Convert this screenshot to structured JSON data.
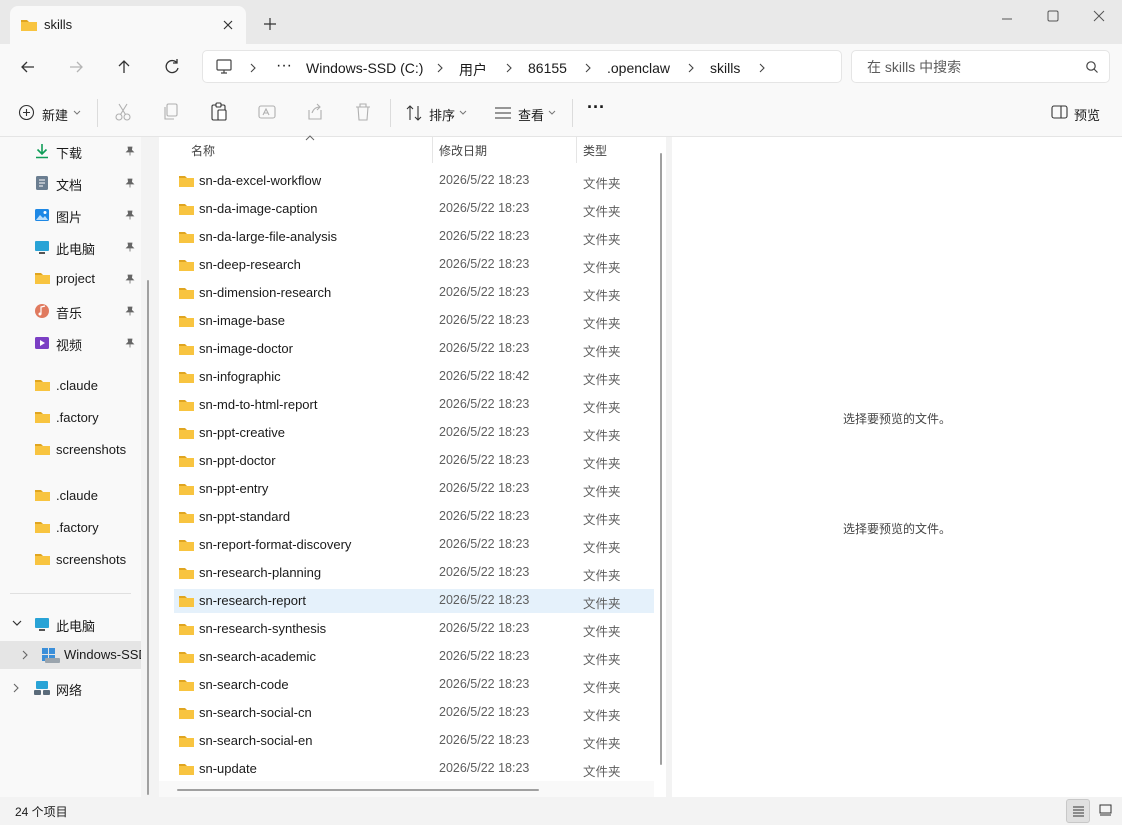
{
  "window": {
    "tab_title": "skills",
    "new_tab_glyph": "+",
    "controls": [
      "minimize-icon",
      "maximize-icon",
      "close-icon"
    ]
  },
  "address": {
    "computer_icon": "computer-icon",
    "more": "···",
    "crumbs": [
      "Windows-SSD (C:)",
      "用户",
      "86155",
      ".openclaw",
      "skills"
    ]
  },
  "search": {
    "placeholder": "在 skills 中搜索"
  },
  "toolbar": {
    "new_label": "新建",
    "sort_label": "排序",
    "view_label": "查看",
    "more_glyph": "···",
    "preview_label": "预览"
  },
  "sidebar": {
    "quick_access": [
      {
        "label": "下载",
        "icon": "download-icon"
      },
      {
        "label": "文档",
        "icon": "document-icon"
      },
      {
        "label": "图片",
        "icon": "pictures-icon"
      },
      {
        "label": "此电脑",
        "icon": "this-pc-icon"
      },
      {
        "label": "project",
        "icon": "folder-icon"
      },
      {
        "label": "音乐",
        "icon": "music-icon"
      },
      {
        "label": "视频",
        "icon": "video-icon"
      }
    ],
    "group1": [
      ".claude",
      ".factory",
      "screenshots"
    ],
    "group2": [
      ".claude",
      ".factory",
      "screenshots"
    ],
    "tree": {
      "this_pc": "此电脑",
      "drive": "Windows-SSD",
      "network": "网络"
    }
  },
  "list": {
    "columns": {
      "name": "名称",
      "date": "修改日期",
      "type": "类型"
    },
    "rows": [
      {
        "name": "sn-da-excel-workflow",
        "date": "2026/5/22 18:23",
        "type": "文件夹"
      },
      {
        "name": "sn-da-image-caption",
        "date": "2026/5/22 18:23",
        "type": "文件夹"
      },
      {
        "name": "sn-da-large-file-analysis",
        "date": "2026/5/22 18:23",
        "type": "文件夹"
      },
      {
        "name": "sn-deep-research",
        "date": "2026/5/22 18:23",
        "type": "文件夹"
      },
      {
        "name": "sn-dimension-research",
        "date": "2026/5/22 18:23",
        "type": "文件夹"
      },
      {
        "name": "sn-image-base",
        "date": "2026/5/22 18:23",
        "type": "文件夹"
      },
      {
        "name": "sn-image-doctor",
        "date": "2026/5/22 18:23",
        "type": "文件夹"
      },
      {
        "name": "sn-infographic",
        "date": "2026/5/22 18:42",
        "type": "文件夹"
      },
      {
        "name": "sn-md-to-html-report",
        "date": "2026/5/22 18:23",
        "type": "文件夹"
      },
      {
        "name": "sn-ppt-creative",
        "date": "2026/5/22 18:23",
        "type": "文件夹"
      },
      {
        "name": "sn-ppt-doctor",
        "date": "2026/5/22 18:23",
        "type": "文件夹"
      },
      {
        "name": "sn-ppt-entry",
        "date": "2026/5/22 18:23",
        "type": "文件夹"
      },
      {
        "name": "sn-ppt-standard",
        "date": "2026/5/22 18:23",
        "type": "文件夹"
      },
      {
        "name": "sn-report-format-discovery",
        "date": "2026/5/22 18:23",
        "type": "文件夹"
      },
      {
        "name": "sn-research-planning",
        "date": "2026/5/22 18:23",
        "type": "文件夹"
      },
      {
        "name": "sn-research-report",
        "date": "2026/5/22 18:23",
        "type": "文件夹",
        "selected": true
      },
      {
        "name": "sn-research-synthesis",
        "date": "2026/5/22 18:23",
        "type": "文件夹"
      },
      {
        "name": "sn-search-academic",
        "date": "2026/5/22 18:23",
        "type": "文件夹"
      },
      {
        "name": "sn-search-code",
        "date": "2026/5/22 18:23",
        "type": "文件夹"
      },
      {
        "name": "sn-search-social-cn",
        "date": "2026/5/22 18:23",
        "type": "文件夹"
      },
      {
        "name": "sn-search-social-en",
        "date": "2026/5/22 18:23",
        "type": "文件夹"
      },
      {
        "name": "sn-update",
        "date": "2026/5/22 18:23",
        "type": "文件夹"
      }
    ]
  },
  "preview": {
    "messages": [
      "选择要预览的文件。",
      "选择要预览的文件。"
    ]
  },
  "status": {
    "count": "24 个项目"
  },
  "colors": {
    "folder": "#f8c440",
    "folder_dark": "#e0a520",
    "selection": "#e5f1fb",
    "accent": "#0067c0"
  }
}
